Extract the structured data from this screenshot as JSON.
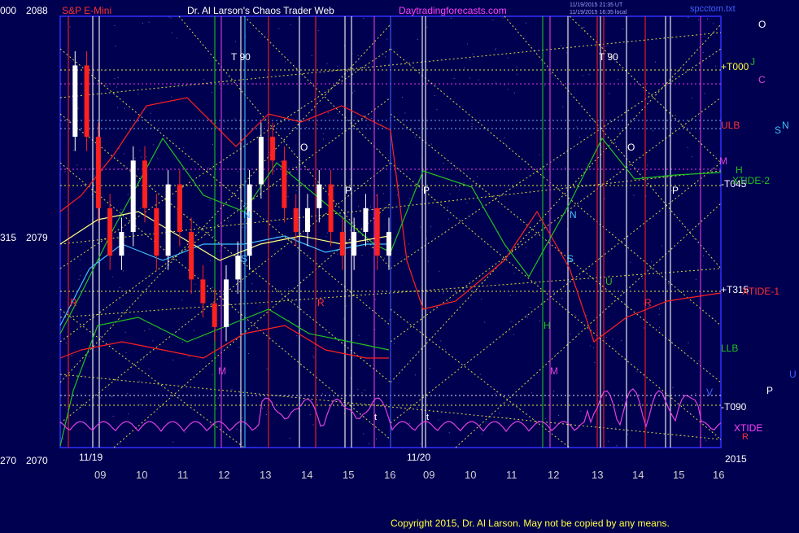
{
  "header": {
    "left_axis_top_a": "000",
    "left_axis_top_b": "2088",
    "symbol": "S&P E-Mini",
    "title": "Dr. Al Larson's Chaos Trader Web",
    "site": "Daytradingforecasts.com",
    "stamp_a": "11/19/2015 21:35 UT",
    "stamp_b": "11/19/2015 16:35 local",
    "file": "spcctom.txt"
  },
  "left_axis": {
    "mid_a": "315",
    "mid_b": "2079",
    "bot_a": "270",
    "bot_b": "2070"
  },
  "x_axis": {
    "date_left": "11/19",
    "date_right": "11/20",
    "year": "2015",
    "ticks_left": [
      "09",
      "10",
      "11",
      "12",
      "13",
      "14",
      "15",
      "16"
    ],
    "ticks_right": [
      "09",
      "10",
      "11",
      "12",
      "13",
      "14",
      "15",
      "16"
    ]
  },
  "right_labels": {
    "o_top": "O",
    "t000": "+T000",
    "j": "J",
    "c": "C",
    "ulb": "ULB",
    "s": "S",
    "n": "N",
    "m": "M",
    "h": "H",
    "t045": "-T045",
    "xtide2": "XTIDE-2",
    "t315": "+T315",
    "xtide1": "XTIDE-1",
    "llb": "LLB",
    "u": "U",
    "v": "V",
    "p": "P",
    "t090": "-T090",
    "xtide": "XTIDE",
    "r": "R"
  },
  "chart_labels": {
    "t90": "T 90",
    "o": "O",
    "p": "P",
    "n": "N",
    "s": "S",
    "r": "R",
    "m": "M",
    "h": "H",
    "u": "U",
    "t": "t"
  },
  "footer": {
    "copyright": "Copyright 2015, Dr. Al Larson. May not be copied by any means."
  },
  "colors": {
    "bg": "#000050",
    "axis": "#3030ff",
    "yellow": "#ffff40",
    "red": "#ff2020",
    "green": "#20c020",
    "magenta": "#e040e0",
    "white": "#ffffff",
    "cyan": "#40c0ff",
    "tick_label": "#d0d0d0",
    "title_white": "#ffffff",
    "site_magenta": "#ff40ff"
  },
  "chart_data": {
    "type": "line",
    "title": "S&P E-Mini",
    "y_axis_price": {
      "ticks": [
        2088,
        2079,
        2070
      ],
      "ylim": [
        2070,
        2088
      ]
    },
    "y_axis_angle": {
      "ticks": [
        "000",
        "315",
        "270"
      ]
    },
    "x_axis_hours": [
      9,
      10,
      11,
      12,
      13,
      14,
      15,
      16
    ],
    "days": [
      "11/19",
      "11/20"
    ],
    "series": [
      {
        "name": "S&P E-Mini",
        "day": "11/19",
        "values": [
          2083,
          2086,
          2083,
          2080,
          2078,
          2079,
          2082,
          2080,
          2078,
          2081,
          2079,
          2077,
          2076,
          2075,
          2077,
          2078,
          2081,
          2083,
          2082,
          2080,
          2079,
          2080,
          2081,
          2079,
          2078,
          2079,
          2080,
          2078,
          2079
        ]
      },
      {
        "name": "ULB",
        "values": []
      },
      {
        "name": "LLB",
        "values": []
      },
      {
        "name": "XTIDE-1",
        "values": []
      },
      {
        "name": "XTIDE-2",
        "values": []
      },
      {
        "name": "XTIDE",
        "values": []
      }
    ],
    "grid": true
  }
}
